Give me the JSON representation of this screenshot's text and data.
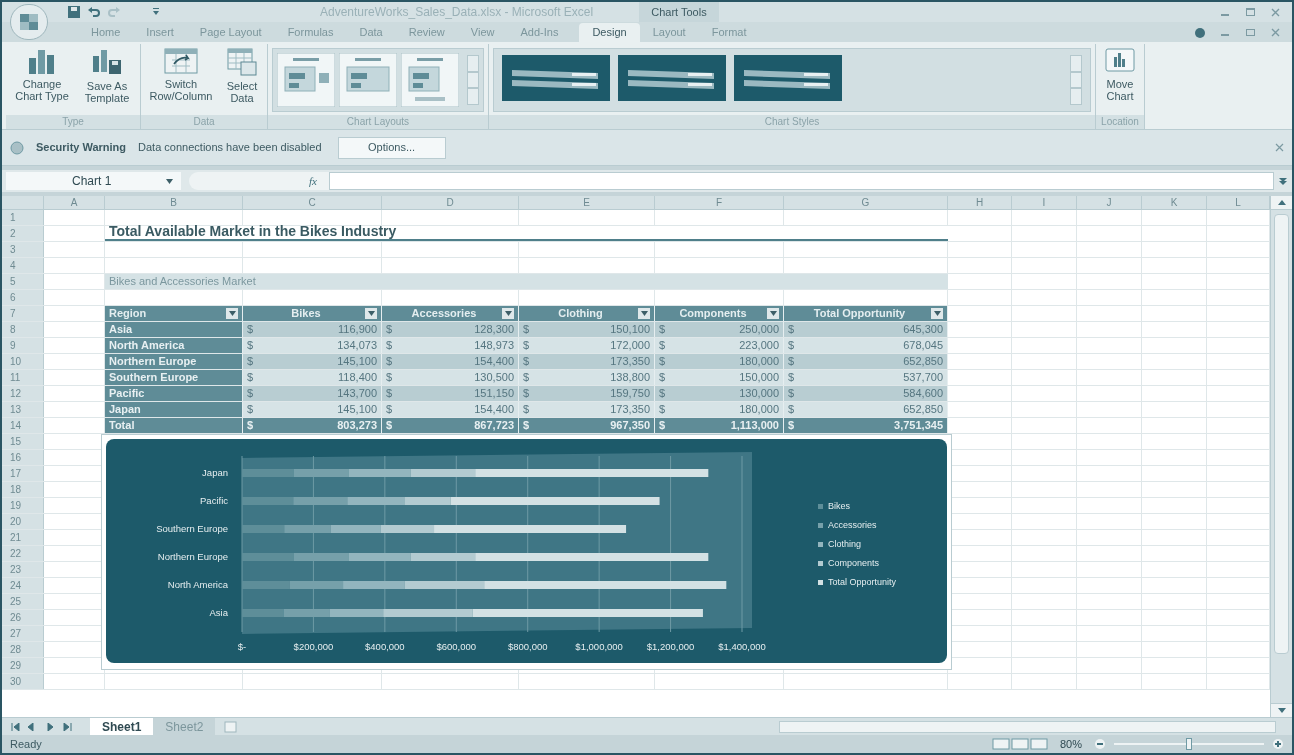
{
  "window": {
    "title": "AdventureWorks_Sales_Data.xlsx - Microsoft Excel",
    "context_title": "Chart Tools"
  },
  "ribbon_tabs": [
    {
      "label": "Home",
      "selected": false
    },
    {
      "label": "Insert",
      "selected": false
    },
    {
      "label": "Page Layout",
      "selected": false
    },
    {
      "label": "Formulas",
      "selected": false
    },
    {
      "label": "Data",
      "selected": false
    },
    {
      "label": "Review",
      "selected": false
    },
    {
      "label": "View",
      "selected": false
    },
    {
      "label": "Add-Ins",
      "selected": false
    },
    {
      "label": "Design",
      "selected": true
    },
    {
      "label": "Layout",
      "selected": false
    },
    {
      "label": "Format",
      "selected": false
    }
  ],
  "ribbon_groups": [
    {
      "label": "Type",
      "kind": "buttons",
      "buttons": [
        "Change Chart Type",
        "Save As Template"
      ]
    },
    {
      "label": "Data",
      "kind": "buttons",
      "buttons": [
        "Switch Row/Column",
        "Select Data"
      ]
    },
    {
      "label": "Chart Layouts",
      "kind": "layouts"
    },
    {
      "label": "Chart Styles",
      "kind": "styles"
    },
    {
      "label": "Location",
      "kind": "buttons",
      "buttons": [
        "Move Chart"
      ]
    }
  ],
  "security_bar": {
    "title": "Security Warning",
    "message": "Data connections have been disabled",
    "button": "Options..."
  },
  "formula_bar": {
    "name_box": "Chart 1",
    "function_label": "fx"
  },
  "columns": [
    "A",
    "B",
    "C",
    "D",
    "E",
    "F",
    "G",
    "H",
    "I",
    "J",
    "K",
    "L"
  ],
  "row_numbers": [
    "1",
    "2",
    "3",
    "4",
    "5",
    "6",
    "7",
    "8",
    "9",
    "10",
    "11",
    "12",
    "13",
    "14",
    "15",
    "16",
    "17",
    "18",
    "19",
    "20",
    "21",
    "22",
    "23",
    "24",
    "25",
    "26",
    "27",
    "28",
    "29",
    "30"
  ],
  "sheet": {
    "title": "Total Available Market in the Bikes Industry",
    "subtitle": "Bikes and Accessories Market",
    "headers": [
      "Region",
      "Bikes",
      "Accessories",
      "Clothing",
      "Components",
      "Total Opportunity"
    ],
    "rows": [
      {
        "region": "Asia",
        "cells": [
          {
            "symbol": "$",
            "amount": "116,900"
          },
          {
            "symbol": "$",
            "amount": "128,300"
          },
          {
            "symbol": "$",
            "amount": "150,100"
          },
          {
            "symbol": "$",
            "amount": "250,000"
          },
          {
            "symbol": "$",
            "amount": "645,300"
          }
        ]
      },
      {
        "region": "North America",
        "cells": [
          {
            "symbol": "$",
            "amount": "134,073"
          },
          {
            "symbol": "$",
            "amount": "148,973"
          },
          {
            "symbol": "$",
            "amount": "172,000"
          },
          {
            "symbol": "$",
            "amount": "223,000"
          },
          {
            "symbol": "$",
            "amount": "678,045"
          }
        ]
      },
      {
        "region": "Northern Europe",
        "cells": [
          {
            "symbol": "$",
            "amount": "145,100"
          },
          {
            "symbol": "$",
            "amount": "154,400"
          },
          {
            "symbol": "$",
            "amount": "173,350"
          },
          {
            "symbol": "$",
            "amount": "180,000"
          },
          {
            "symbol": "$",
            "amount": "652,850"
          }
        ]
      },
      {
        "region": "Southern Europe",
        "cells": [
          {
            "symbol": "$",
            "amount": "118,400"
          },
          {
            "symbol": "$",
            "amount": "130,500"
          },
          {
            "symbol": "$",
            "amount": "138,800"
          },
          {
            "symbol": "$",
            "amount": "150,000"
          },
          {
            "symbol": "$",
            "amount": "537,700"
          }
        ]
      },
      {
        "region": "Pacific",
        "cells": [
          {
            "symbol": "$",
            "amount": "143,700"
          },
          {
            "symbol": "$",
            "amount": "151,150"
          },
          {
            "symbol": "$",
            "amount": "159,750"
          },
          {
            "symbol": "$",
            "amount": "130,000"
          },
          {
            "symbol": "$",
            "amount": "584,600"
          }
        ]
      },
      {
        "region": "Japan",
        "cells": [
          {
            "symbol": "$",
            "amount": "145,100"
          },
          {
            "symbol": "$",
            "amount": "154,400"
          },
          {
            "symbol": "$",
            "amount": "173,350"
          },
          {
            "symbol": "$",
            "amount": "180,000"
          },
          {
            "symbol": "$",
            "amount": "652,850"
          }
        ]
      }
    ],
    "total": {
      "region": "Total",
      "cells": [
        {
          "symbol": "$",
          "amount": "803,273"
        },
        {
          "symbol": "$",
          "amount": "867,723"
        },
        {
          "symbol": "$",
          "amount": "967,350"
        },
        {
          "symbol": "$",
          "amount": "1,113,000"
        },
        {
          "symbol": "$",
          "amount": "3,751,345"
        }
      ]
    }
  },
  "chart": {
    "chart_data": {
      "type": "bar",
      "orientation": "horizontal",
      "stacked": true,
      "grid": true,
      "legend": true,
      "categories": [
        "Japan",
        "Pacific",
        "Southern Europe",
        "Northern Europe",
        "North America",
        "Asia"
      ],
      "series": [
        {
          "name": "Bikes",
          "color": "#5e8e99",
          "values": [
            145100,
            143700,
            118400,
            145100,
            134073,
            116900
          ]
        },
        {
          "name": "Accessories",
          "color": "#76a0aa",
          "values": [
            154400,
            151150,
            130500,
            154400,
            148973,
            128300
          ]
        },
        {
          "name": "Clothing",
          "color": "#93b5be",
          "values": [
            173350,
            159750,
            138800,
            173350,
            172000,
            150100
          ]
        },
        {
          "name": "Components",
          "color": "#b3cbd1",
          "values": [
            180000,
            130000,
            150000,
            180000,
            223000,
            250000
          ]
        },
        {
          "name": "Total Opportunity",
          "color": "#d3e1e4",
          "values": [
            652850,
            584600,
            537700,
            652850,
            678045,
            645300
          ]
        }
      ],
      "xlim": [
        0,
        1400000
      ],
      "xticks": [
        {
          "value": 0,
          "label": "$-"
        },
        {
          "value": 200000,
          "label": "$200,000"
        },
        {
          "value": 400000,
          "label": "$400,000"
        },
        {
          "value": 600000,
          "label": "$600,000"
        },
        {
          "value": 800000,
          "label": "$800,000"
        },
        {
          "value": 1000000,
          "label": "$1,000,000"
        },
        {
          "value": 1200000,
          "label": "$1,200,000"
        },
        {
          "value": 1400000,
          "label": "$1,400,000"
        }
      ]
    }
  },
  "sheet_tabs": [
    {
      "label": "Sheet1",
      "selected": true
    },
    {
      "label": "Sheet2",
      "selected": false
    }
  ],
  "status_bar": {
    "status": "Ready",
    "zoom": "80%",
    "zoom_slider": {
      "level": 0.5
    }
  }
}
